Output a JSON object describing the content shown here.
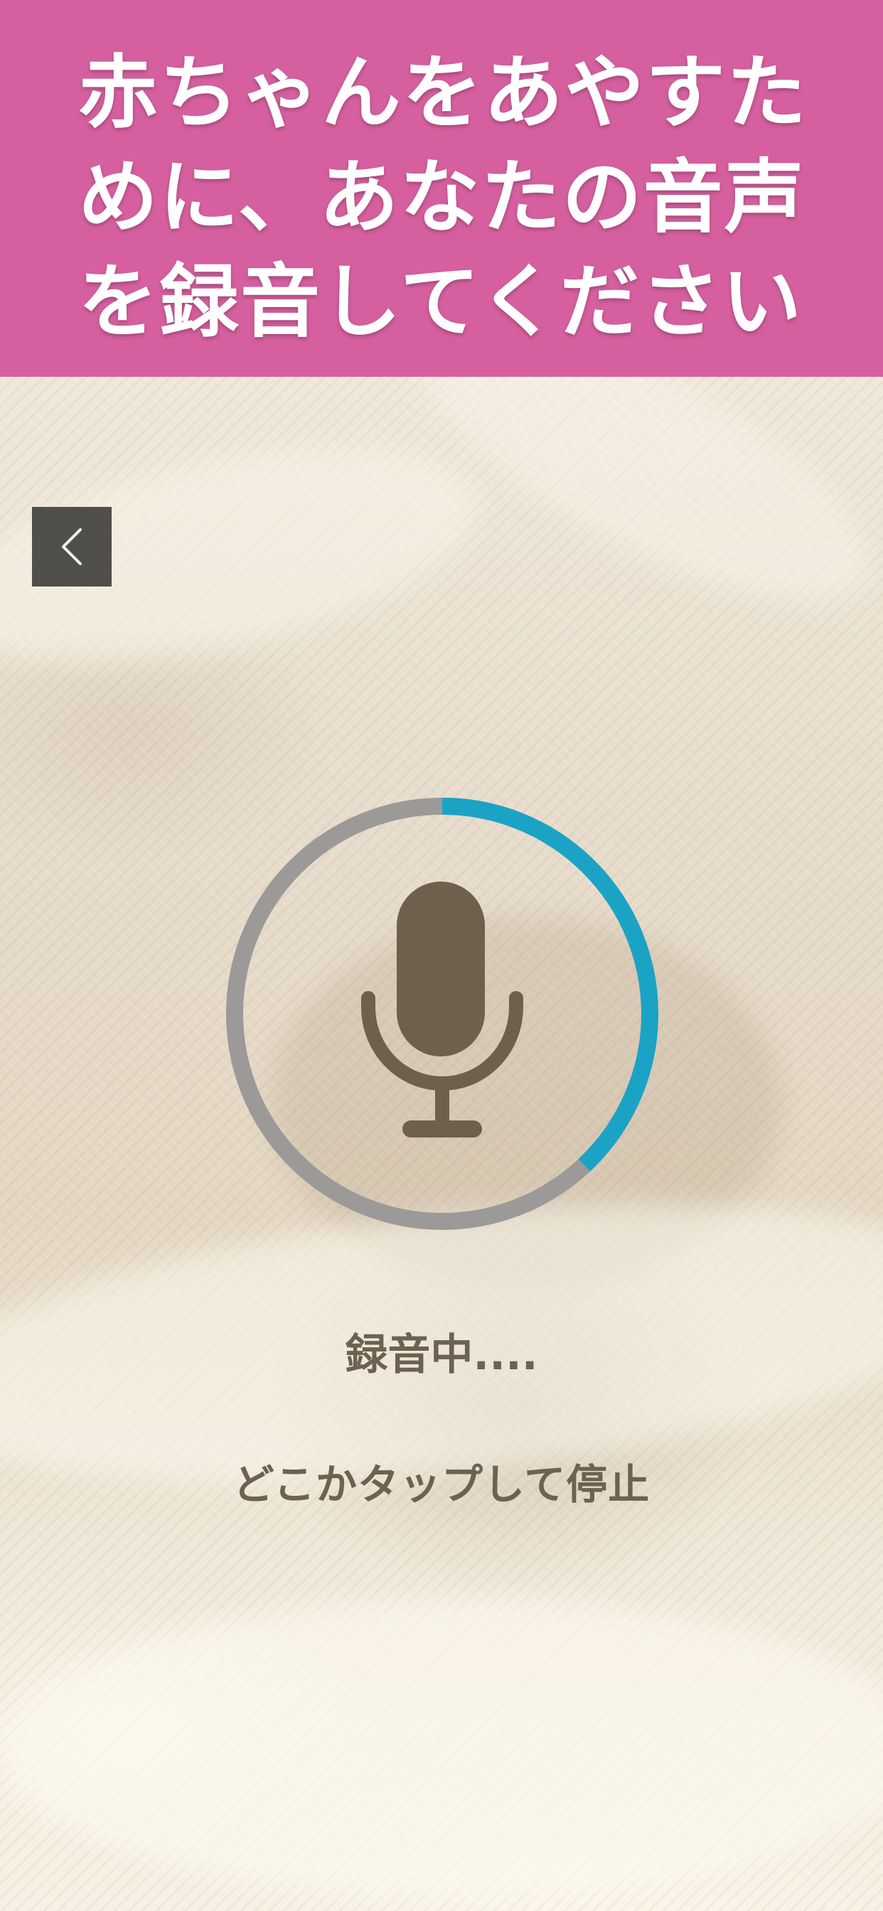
{
  "banner": {
    "line1": "赤ちゃんをあやすた",
    "line2": "めに、あなたの音声",
    "line3": "を録音してください",
    "background_color": "#d6609f",
    "text_color": "#ffffff"
  },
  "navigation": {
    "back_icon": "chevron-left-icon"
  },
  "recorder": {
    "status_label": "録音中....",
    "hint_label": "どこかタップして停止",
    "progress_fraction": 0.38,
    "progress_color": "#1ba3c6",
    "track_color": "#9b9a98",
    "mic_icon": "microphone-icon",
    "mic_color": "#6f604d"
  }
}
